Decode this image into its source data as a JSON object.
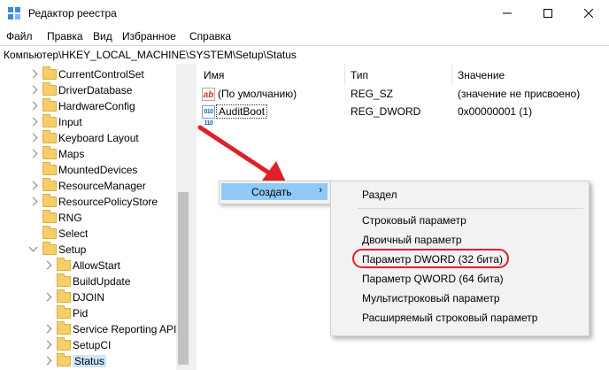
{
  "window": {
    "title": "Редактор реестра",
    "minimize_icon": "minimize-icon",
    "maximize_icon": "maximize-icon",
    "close_icon": "close-icon"
  },
  "menu": [
    "Файл",
    "Правка",
    "Вид",
    "Избранное",
    "Справка"
  ],
  "address": "Компьютер\\HKEY_LOCAL_MACHINE\\SYSTEM\\Setup\\Status",
  "tree": {
    "items": [
      {
        "label": "CurrentControlSet",
        "level": 1,
        "expander": "closed"
      },
      {
        "label": "DriverDatabase",
        "level": 1,
        "expander": "closed"
      },
      {
        "label": "HardwareConfig",
        "level": 1,
        "expander": "closed"
      },
      {
        "label": "Input",
        "level": 1,
        "expander": "closed"
      },
      {
        "label": "Keyboard Layout",
        "level": 1,
        "expander": "closed"
      },
      {
        "label": "Maps",
        "level": 1,
        "expander": "closed"
      },
      {
        "label": "MountedDevices",
        "level": 1,
        "expander": "none"
      },
      {
        "label": "ResourceManager",
        "level": 1,
        "expander": "closed"
      },
      {
        "label": "ResourcePolicyStore",
        "level": 1,
        "expander": "closed"
      },
      {
        "label": "RNG",
        "level": 1,
        "expander": "none"
      },
      {
        "label": "Select",
        "level": 1,
        "expander": "none"
      },
      {
        "label": "Setup",
        "level": 1,
        "expander": "open"
      },
      {
        "label": "AllowStart",
        "level": 2,
        "expander": "closed"
      },
      {
        "label": "BuildUpdate",
        "level": 2,
        "expander": "none"
      },
      {
        "label": "DJOIN",
        "level": 2,
        "expander": "closed"
      },
      {
        "label": "Pid",
        "level": 2,
        "expander": "none"
      },
      {
        "label": "Service Reporting API",
        "level": 2,
        "expander": "closed"
      },
      {
        "label": "SetupCI",
        "level": 2,
        "expander": "closed"
      },
      {
        "label": "Status",
        "level": 2,
        "expander": "closed",
        "selected": true
      }
    ]
  },
  "values": {
    "headers": {
      "name": "Имя",
      "type": "Тип",
      "data": "Значение"
    },
    "rows": [
      {
        "icon": "string-value-icon",
        "icon_text": "ab",
        "name": "(По умолчанию)",
        "type": "REG_SZ",
        "data": "(значение не присвоено)"
      },
      {
        "icon": "binary-value-icon",
        "icon_text": "010 110",
        "name": "AuditBoot",
        "type": "REG_DWORD",
        "data": "0x00000001 (1)"
      }
    ]
  },
  "context_menu": {
    "create_label": "Создать",
    "create_arrow": "›"
  },
  "submenu": {
    "items": [
      "Раздел",
      "Строковый параметр",
      "Двоичный параметр",
      "Параметр DWORD (32 бита)",
      "Параметр QWORD (64 бита)",
      "Мультистроковый параметр",
      "Расширяемый строковый параметр"
    ]
  },
  "colors": {
    "annotation_red": "#e0202a",
    "menu_highlight": "#91c9f7",
    "folder_yellow": "#f4cf68"
  }
}
